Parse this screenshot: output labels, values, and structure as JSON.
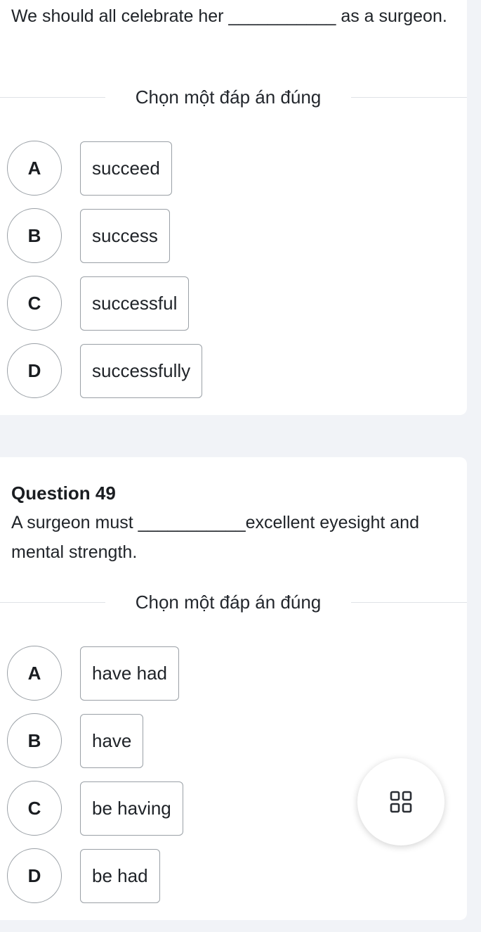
{
  "question_48": {
    "text": "We should all celebrate her ___________ as a surgeon.",
    "prompt": "Chọn một đáp án đúng",
    "options": [
      {
        "letter": "A",
        "text": "succeed"
      },
      {
        "letter": "B",
        "text": "success"
      },
      {
        "letter": "C",
        "text": "successful"
      },
      {
        "letter": "D",
        "text": "successfully"
      }
    ]
  },
  "question_49": {
    "title": "Question 49",
    "text": "A surgeon must ___________excellent eyesight and mental strength.",
    "prompt": "Chọn một đáp án đúng",
    "options": [
      {
        "letter": "A",
        "text": "have had"
      },
      {
        "letter": "B",
        "text": "have"
      },
      {
        "letter": "C",
        "text": "be having"
      },
      {
        "letter": "D",
        "text": "be had"
      }
    ]
  },
  "fab": {
    "icon": "grid-icon"
  }
}
